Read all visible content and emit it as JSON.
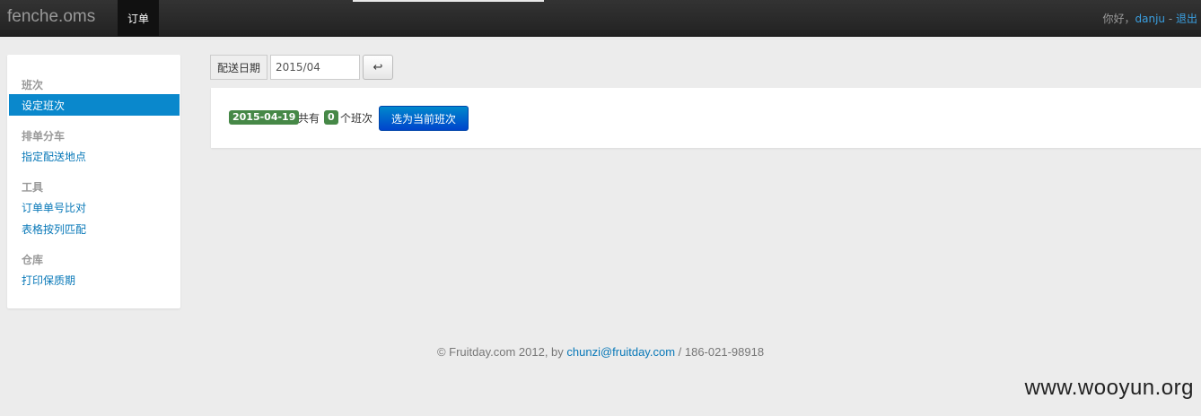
{
  "navbar": {
    "brand": "fenche.oms",
    "active_tab": "订单",
    "greeting": "你好，",
    "username": "danju",
    "separator": " - ",
    "logout": "退出"
  },
  "sidebar": {
    "sections": [
      {
        "header": "班次",
        "items": [
          "设定班次"
        ]
      },
      {
        "header": "排单分车",
        "items": [
          "指定配送地点"
        ]
      },
      {
        "header": "工具",
        "items": [
          "订单单号比对",
          "表格按列匹配"
        ]
      },
      {
        "header": "仓库",
        "items": [
          "打印保质期"
        ]
      }
    ],
    "active_item": "设定班次"
  },
  "date_form": {
    "label": "配送日期",
    "value": "2015/04",
    "go_glyph": "↩"
  },
  "panel": {
    "date_badge": "2015-04-19",
    "text_total": "共有",
    "count_badge": "0",
    "text_unit": "个班次",
    "select_button": "选为当前班次"
  },
  "footer": {
    "prefix": "© Fruitday.com 2012, by ",
    "email": "chunzi@fruitday.com",
    "suffix": " / 186-021-98918"
  },
  "watermark": "www.wooyun.org"
}
